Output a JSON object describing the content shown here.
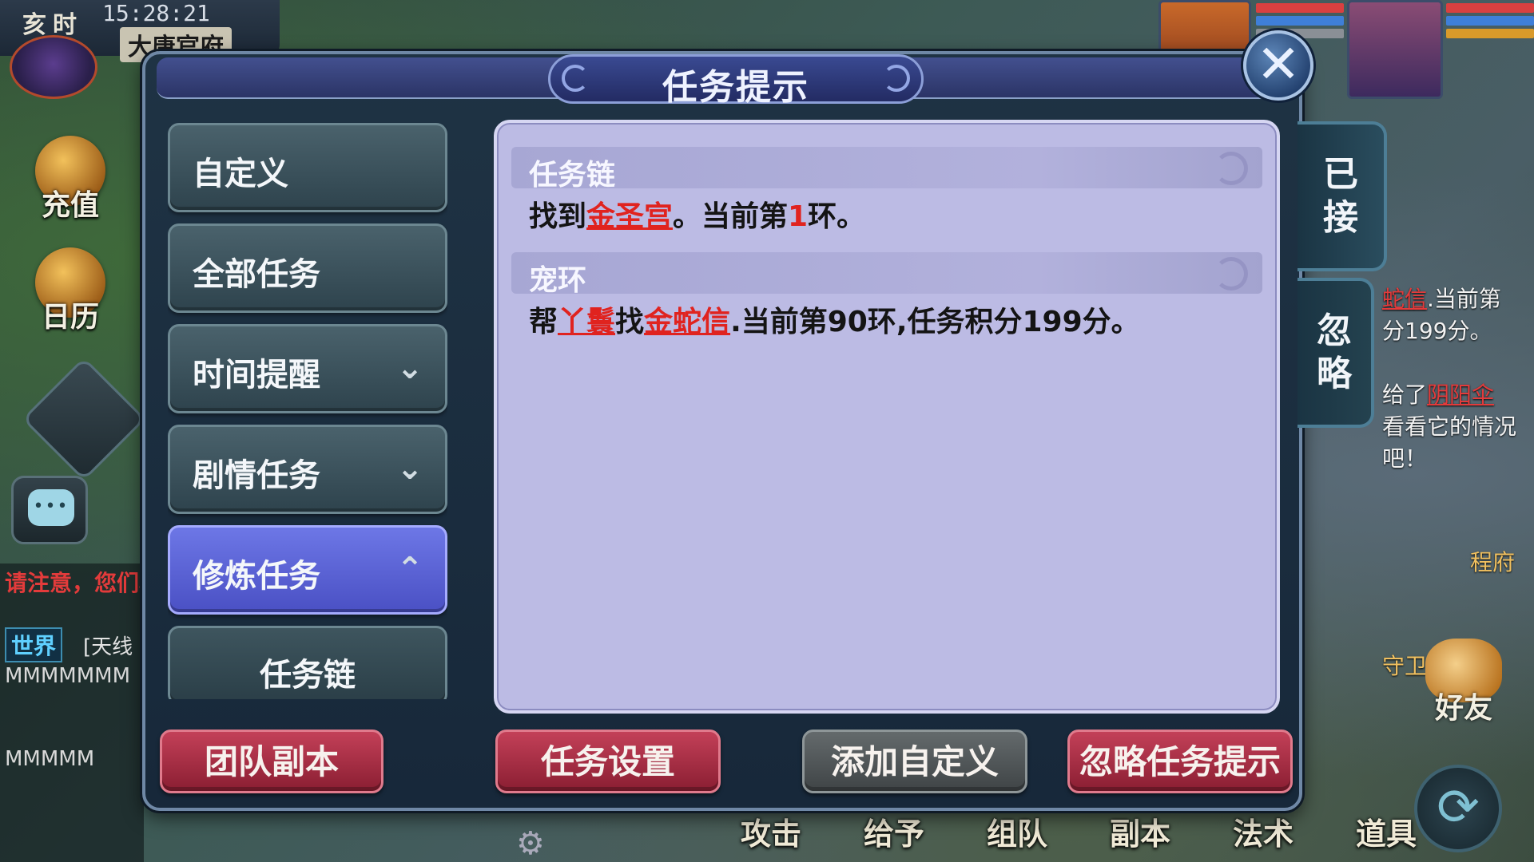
{
  "hud": {
    "shichen": "亥时",
    "clock": "15:28:21",
    "location": "大唐官府",
    "recharge_label": "充值",
    "calendar_label": "日历",
    "friend_label": "好友"
  },
  "chat": {
    "warning": "请注意，您们相互之间发布",
    "channel": "世界",
    "sender": "[天线",
    "line1": "MMMMMMM",
    "line2": "MMMMM"
  },
  "right_ghost": {
    "line1_link": "蛇信",
    "line1_text": ".当前第",
    "line2": "分199分。",
    "line3_text": "给了",
    "line3_link": "阴阳伞",
    "line4": "看看它的情况吧！",
    "npc": "程府",
    "guard": "守卫"
  },
  "bottom_bar": [
    "攻击",
    "给予",
    "组队",
    "副本",
    "法术",
    "道具"
  ],
  "modal": {
    "title": "任务提示",
    "close_symbol": "✕",
    "side_tabs": {
      "accepted": "已接",
      "ignored": "忽略"
    },
    "nav": [
      {
        "label": "自定义",
        "chevron": ""
      },
      {
        "label": "全部任务",
        "chevron": ""
      },
      {
        "label": "时间提醒",
        "chevron": "⌄"
      },
      {
        "label": "剧情任务",
        "chevron": "⌄"
      },
      {
        "label": "修炼任务",
        "chevron": "⌃"
      },
      {
        "label": "任务链",
        "chevron": ""
      }
    ],
    "sections": [
      {
        "title": "任务链",
        "t1": "找到",
        "link1": "金圣宫",
        "t2": "。当前第",
        "num": "1",
        "t3": "环。"
      },
      {
        "title": "宠环",
        "t1": "帮",
        "link1": "丫鬟",
        "t2": "找",
        "link2": "金蛇信",
        "t3": ".当前第90环,任务积分199分。"
      }
    ],
    "actions": {
      "team_dungeon": "团队副本",
      "task_settings": "任务设置",
      "add_custom": "添加自定义",
      "ignore_hint": "忽略任务提示"
    }
  },
  "colors": {
    "accent_purple": "#5b61d6",
    "link_red": "#e0231f",
    "content_bg": "#bcbbe4"
  }
}
